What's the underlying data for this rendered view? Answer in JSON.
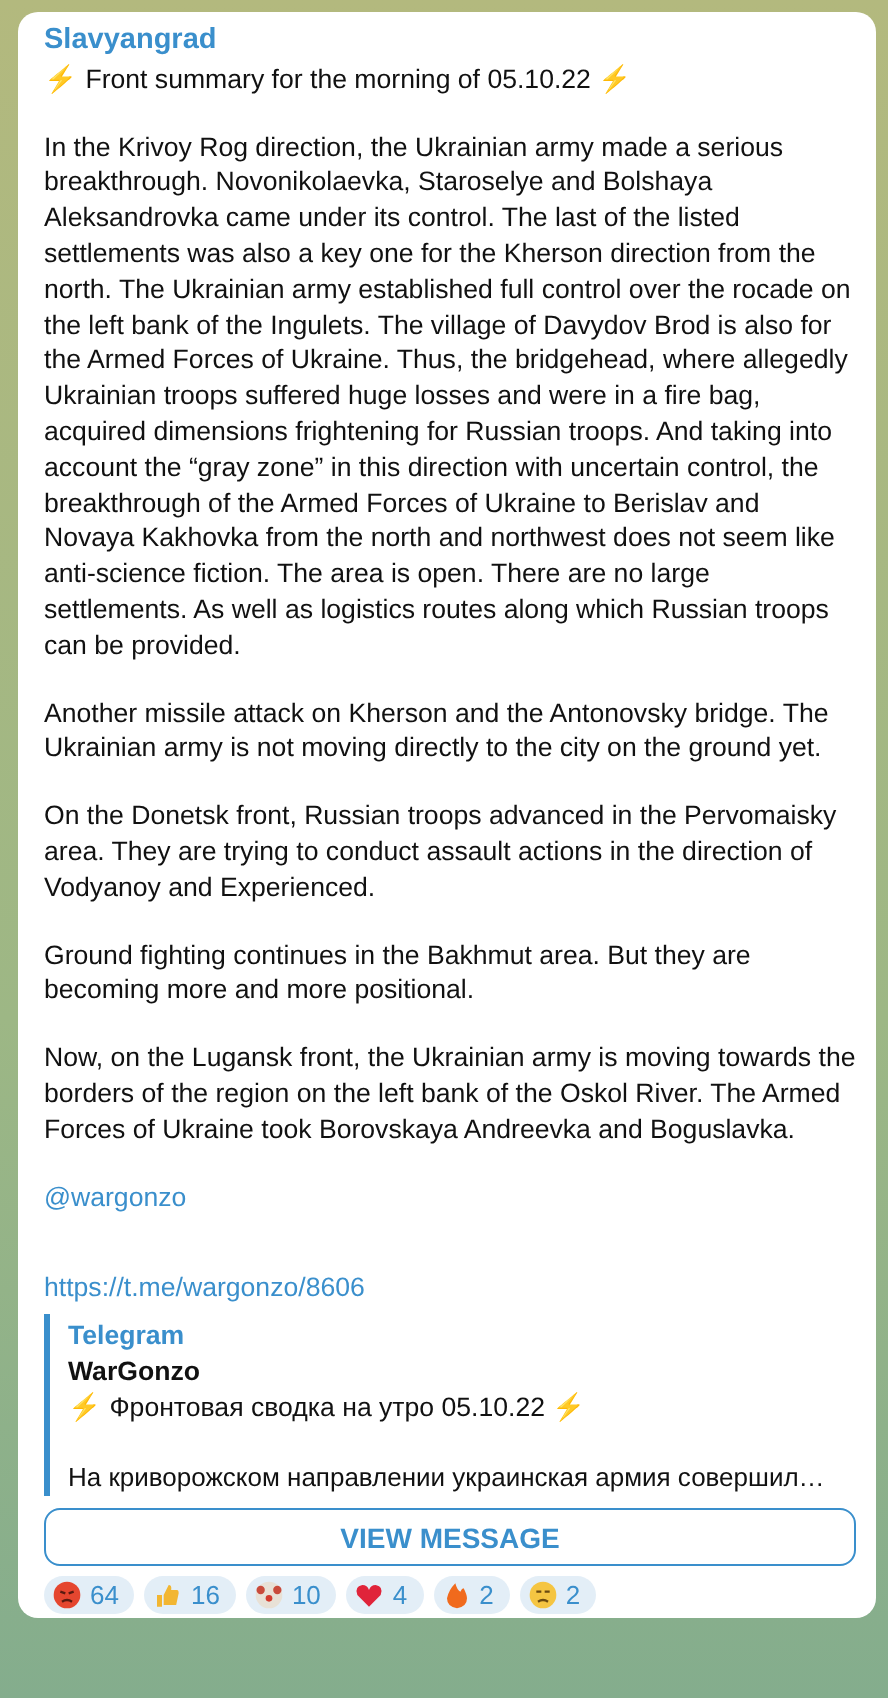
{
  "message": {
    "channel": "Slavyangrad",
    "title": "⚡ Front summary for the morning of 05.10.22 ⚡",
    "paragraphs": [
      "In the Krivoy Rog direction, the Ukrainian army made a serious breakthrough. Novonikolaevka, Staroselye and Bolshaya Aleksandrovka came under its control. The last of the listed settlements was also a key one for the Kherson direction from the north. The Ukrainian army established full control over the rocade on the left bank of the Ingulets. The village of Davydov Brod is also for the Armed Forces of Ukraine. Thus, the bridgehead, where allegedly Ukrainian troops suffered huge losses and were in a fire bag, acquired dimensions frightening for Russian troops. And taking into account the “gray zone” in this direction with uncertain control, the breakthrough of the Armed Forces of Ukraine to Berislav and Novaya Kakhovka from the north and northwest does not seem like anti-science fiction. The area is open. There are no large settlements. As well as logistics routes along which Russian troops can be provided.",
      "Another missile attack on Kherson and the Antonovsky bridge. The Ukrainian army is not moving directly to the city on the ground yet.",
      "On the Donetsk front, Russian troops advanced in the Pervomaisky area. They are trying to conduct assault actions in the direction of Vodyanoy and Experienced.",
      "Ground fighting continues in the Bakhmut area. But they are becoming more and more positional.",
      "Now, on the Lugansk front, the Ukrainian army is moving towards the borders of the region on the left bank of the Oskol River. The Armed Forces of Ukraine took Borovskaya Andreevka and Boguslavka."
    ],
    "mention": "@wargonzo",
    "link": "https://t.me/wargonzo/8606",
    "preview": {
      "site": "Telegram",
      "title": "WarGonzo",
      "headline": "⚡ Фронтовая сводка на утро 05.10.22 ⚡",
      "excerpt": "На криворожском направлении украинская армия совершил…"
    },
    "button": "VIEW MESSAGE",
    "reactions": [
      {
        "count": "64"
      },
      {
        "count": "16"
      },
      {
        "count": "10"
      },
      {
        "count": "4"
      },
      {
        "count": "2"
      },
      {
        "count": "2"
      }
    ]
  }
}
